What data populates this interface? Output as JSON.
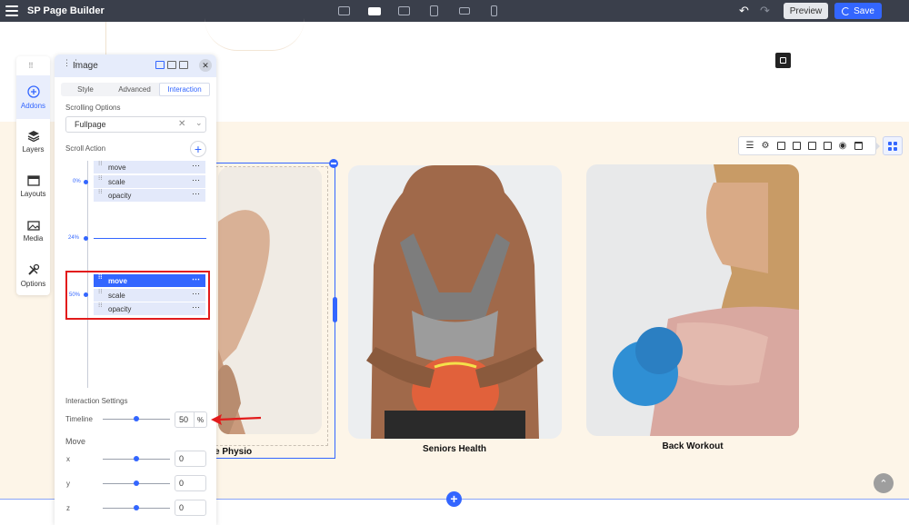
{
  "app": {
    "title": "SP Page Builder"
  },
  "toolbar": {
    "preview_label": "Preview",
    "save_label": "Save",
    "devices": [
      "desktop-wide-icon",
      "desktop-icon",
      "laptop-icon",
      "tablet-icon",
      "tablet-landscape-icon",
      "mobile-icon"
    ],
    "active_device": "desktop-icon"
  },
  "sidebar": {
    "items": [
      {
        "label": "Addons",
        "icon": "plus-circle-icon",
        "active": true
      },
      {
        "label": "Layers",
        "icon": "layers-icon",
        "active": false
      },
      {
        "label": "Layouts",
        "icon": "layout-icon",
        "active": false
      },
      {
        "label": "Media",
        "icon": "media-icon",
        "active": false
      },
      {
        "label": "Options",
        "icon": "tools-icon",
        "active": false
      }
    ]
  },
  "panel": {
    "title": "Image",
    "tabs": [
      {
        "label": "Style",
        "active": false
      },
      {
        "label": "Advanced",
        "active": false
      },
      {
        "label": "Interaction",
        "active": true
      }
    ],
    "scrolling_options_label": "Scrolling Options",
    "scrolling_select_value": "Fullpage",
    "scroll_action_label": "Scroll Action",
    "timeline_points": [
      {
        "percent_label": "0%",
        "actions": [
          "move",
          "scale",
          "opacity"
        ],
        "selected": false
      },
      {
        "percent_label": "24%",
        "actions": [],
        "selected": false
      },
      {
        "percent_label": "50%",
        "actions": [
          "move",
          "scale",
          "opacity"
        ],
        "selected": true
      }
    ],
    "interaction_settings_label": "Interaction Settings",
    "timeline": {
      "label": "Timeline",
      "value": "50",
      "unit": "%",
      "slider_fraction": 0.5
    },
    "move_label": "Move",
    "move_axes": [
      {
        "label": "x",
        "value": "0",
        "slider_fraction": 0.5
      },
      {
        "label": "y",
        "value": "0",
        "slider_fraction": 0.5
      },
      {
        "label": "z",
        "value": "0",
        "slider_fraction": 0.5
      }
    ]
  },
  "cards": [
    {
      "label": "e Physio"
    },
    {
      "label": "Seniors Health"
    },
    {
      "label": "Back Workout"
    }
  ],
  "colors": {
    "accent": "#3366ff",
    "topbar": "#3a3f4b",
    "cream": "#fdf5e8",
    "highlight_red": "#e21b1b"
  }
}
